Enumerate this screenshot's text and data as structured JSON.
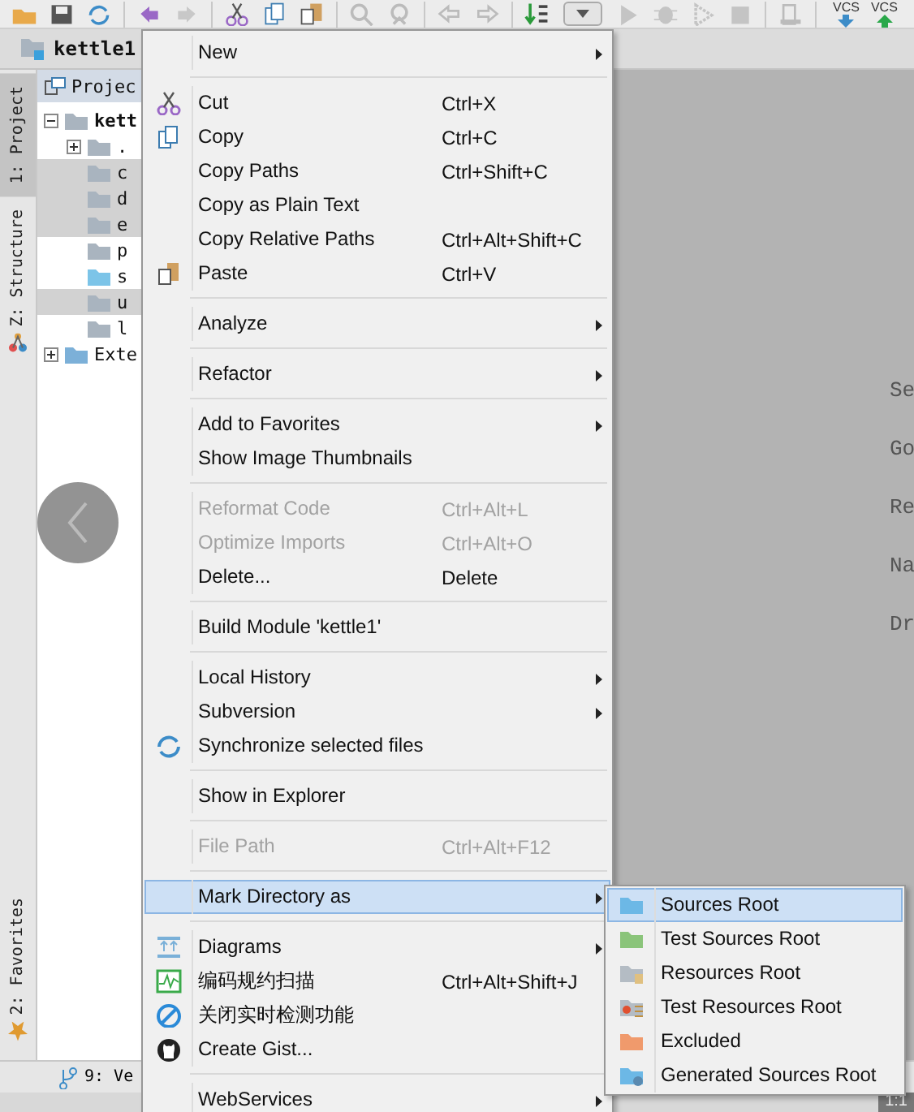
{
  "toolbar": {
    "vcs_buttons": [
      {
        "label": "VCS"
      },
      {
        "label": "VCS"
      }
    ]
  },
  "breadcrumb": {
    "label": "kettle1"
  },
  "tool_strip": {
    "tabs": [
      {
        "label": "1: Project",
        "selected": true
      },
      {
        "label": "Z: Structure",
        "selected": false
      },
      {
        "label": "2: Favorites",
        "selected": false
      }
    ]
  },
  "project_panel": {
    "title": "Projec",
    "tree": [
      {
        "label": "kett",
        "expanded": true,
        "selected": false,
        "children": [
          {
            "label": ".",
            "expanded": false,
            "selected": false
          },
          {
            "label": "c",
            "selected": true
          },
          {
            "label": "d",
            "selected": true
          },
          {
            "label": "e",
            "selected": true
          },
          {
            "label": "p",
            "selected": false
          },
          {
            "label": "s",
            "selected": false
          },
          {
            "label": "u",
            "selected": true
          },
          {
            "label": "l",
            "selected": false
          }
        ]
      },
      {
        "label": "Exte",
        "expanded": false,
        "selected": false
      }
    ]
  },
  "editor": {
    "hints": [
      "Se",
      "Go",
      "Re",
      "Na",
      "Dr"
    ]
  },
  "bottom_bar": {
    "tab": "9: Ve",
    "position": "1:1"
  },
  "context_menu": {
    "groups": [
      [
        {
          "label": "New",
          "submenu": true,
          "disabled": false,
          "selected": false
        }
      ],
      [
        {
          "label": "Cut",
          "shortcut": "Ctrl+X",
          "submenu": false,
          "disabled": false,
          "selected": false
        },
        {
          "label": "Copy",
          "shortcut": "Ctrl+C",
          "submenu": false,
          "disabled": false,
          "selected": false
        },
        {
          "label": "Copy Paths",
          "shortcut": "Ctrl+Shift+C",
          "submenu": false,
          "disabled": false,
          "selected": false
        },
        {
          "label": "Copy as Plain Text",
          "submenu": false,
          "disabled": false,
          "selected": false
        },
        {
          "label": "Copy Relative Paths",
          "shortcut": "Ctrl+Alt+Shift+C",
          "submenu": false,
          "disabled": false,
          "selected": false
        },
        {
          "label": "Paste",
          "shortcut": "Ctrl+V",
          "submenu": false,
          "disabled": false,
          "selected": false
        }
      ],
      [
        {
          "label": "Analyze",
          "submenu": true,
          "disabled": false,
          "selected": false
        }
      ],
      [
        {
          "label": "Refactor",
          "submenu": true,
          "disabled": false,
          "selected": false
        }
      ],
      [
        {
          "label": "Add to Favorites",
          "submenu": true,
          "disabled": false,
          "selected": false
        },
        {
          "label": "Show Image Thumbnails",
          "submenu": false,
          "disabled": false,
          "selected": false
        }
      ],
      [
        {
          "label": "Reformat Code",
          "shortcut": "Ctrl+Alt+L",
          "submenu": false,
          "disabled": true,
          "selected": false
        },
        {
          "label": "Optimize Imports",
          "shortcut": "Ctrl+Alt+O",
          "submenu": false,
          "disabled": true,
          "selected": false
        },
        {
          "label": "Delete...",
          "shortcut": "Delete",
          "submenu": false,
          "disabled": false,
          "selected": false
        }
      ],
      [
        {
          "label": "Build Module 'kettle1'",
          "submenu": false,
          "disabled": false,
          "selected": false
        }
      ],
      [
        {
          "label": "Local History",
          "submenu": true,
          "disabled": false,
          "selected": false
        },
        {
          "label": "Subversion",
          "submenu": true,
          "disabled": false,
          "selected": false
        },
        {
          "label": "Synchronize selected files",
          "submenu": false,
          "disabled": false,
          "selected": false
        }
      ],
      [
        {
          "label": "Show in Explorer",
          "submenu": false,
          "disabled": false,
          "selected": false
        }
      ],
      [
        {
          "label": "File Path",
          "shortcut": "Ctrl+Alt+F12",
          "submenu": false,
          "disabled": true,
          "selected": false
        }
      ],
      [
        {
          "label": "Mark Directory as",
          "submenu": true,
          "disabled": false,
          "selected": true
        }
      ],
      [
        {
          "label": "Diagrams",
          "submenu": true,
          "disabled": false,
          "selected": false
        },
        {
          "label": "编码规约扫描",
          "shortcut": "Ctrl+Alt+Shift+J",
          "submenu": false,
          "disabled": false,
          "selected": false
        },
        {
          "label": "关闭实时检测功能",
          "submenu": false,
          "disabled": false,
          "selected": false
        },
        {
          "label": "Create Gist...",
          "submenu": false,
          "disabled": false,
          "selected": false
        }
      ],
      [
        {
          "label": "WebServices",
          "submenu": true,
          "disabled": false,
          "selected": false
        }
      ]
    ]
  },
  "submenu": {
    "items": [
      {
        "label": "Sources Root",
        "color": "#6cb8e6",
        "selected": true
      },
      {
        "label": "Test Sources Root",
        "color": "#8ac47a",
        "selected": false
      },
      {
        "label": "Resources Root",
        "color": "#b4bcc4",
        "selected": false
      },
      {
        "label": "Test Resources Root",
        "color": "#b4bcc4",
        "selected": false
      },
      {
        "label": "Excluded",
        "color": "#f09a6c",
        "selected": false
      },
      {
        "label": "Generated Sources Root",
        "color": "#6cb8e6",
        "selected": false
      }
    ]
  }
}
